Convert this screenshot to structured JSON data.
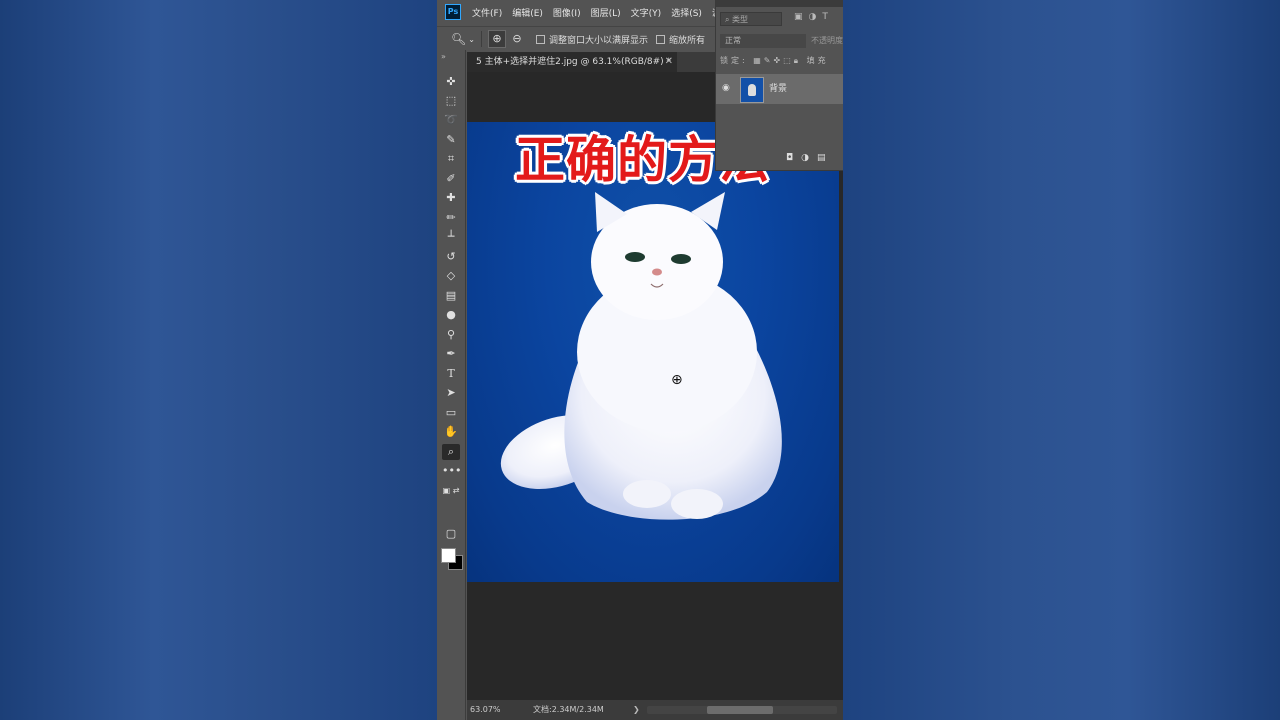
{
  "menu": {
    "items": [
      "文件(F)",
      "编辑(E)",
      "图像(I)",
      "图层(L)",
      "文字(Y)",
      "选择(S)",
      "滤"
    ]
  },
  "options_bar": {
    "checkbox1_label": "调整窗口大小以满屏显示",
    "checkbox2_label": "缩放所有"
  },
  "document": {
    "tab_title": "5 主体+选择并遮住2.jpg @ 63.1%(RGB/8#) *",
    "overlay_text": "正确的方法"
  },
  "status": {
    "zoom": "63.07%",
    "doc_size": "文档:2.34M/2.34M"
  },
  "layers_panel": {
    "filter_placeholder": "类型",
    "blend_mode": "正常",
    "opacity_label": "不透明度",
    "lock_label": "锁定:",
    "fill_label": "填充",
    "layer_name": "背景"
  }
}
